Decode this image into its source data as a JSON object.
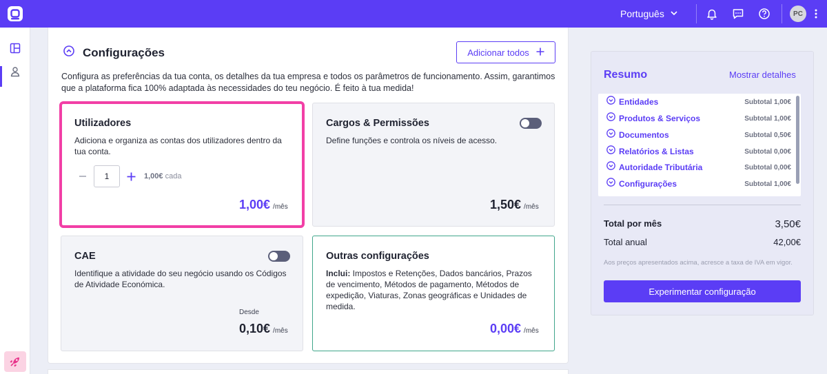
{
  "topbar": {
    "language": "Português",
    "avatar_initials": "PC",
    "brand_color": "#5b3df5"
  },
  "section": {
    "title": "Configurações",
    "add_all_label": "Adicionar todos",
    "description": "Configura as preferências da tua conta, os detalhes da tua empresa e todos os parâmetros de funcionamento. Assim, garantimos que a plataforma fica 100% adaptada às necessidades do teu negócio. É feito à tua medida!"
  },
  "cards": {
    "utilizadores": {
      "title": "Utilizadores",
      "description": "Adiciona e organiza as contas dos utilizadores dentro da tua conta.",
      "quantity": "1",
      "unit_price": "1,00€",
      "unit_suffix": "cada",
      "price": "1,00€",
      "period": "/mês"
    },
    "cargos": {
      "title": "Cargos & Permissões",
      "description": "Define funções e controla os níveis de acesso.",
      "price": "1,50€",
      "period": "/mês",
      "enabled": false
    },
    "cae": {
      "title": "CAE",
      "description": "Identifique a atividade do seu negócio usando os Códigos de Atividade Económica.",
      "from_label": "Desde",
      "price": "0,10€",
      "period": "/mês",
      "enabled": false
    },
    "outras": {
      "title": "Outras configurações",
      "includes_label": "Inclui:",
      "description": " Impostos e Retenções, Dados bancários, Prazos de vencimento, Métodos de pagamento, Métodos de expedição, Viaturas, Zonas geográficas e Unidades de medida.",
      "price": "0,00€",
      "period": "/mês"
    }
  },
  "summary": {
    "title": "Resumo",
    "details_link": "Mostrar detalhes",
    "items": [
      {
        "label": "Entidades",
        "subtotal": "Subtotal 1,00€"
      },
      {
        "label": "Produtos & Serviços",
        "subtotal": "Subtotal 1,00€"
      },
      {
        "label": "Documentos",
        "subtotal": "Subtotal 0,50€"
      },
      {
        "label": "Relatórios & Listas",
        "subtotal": "Subtotal 0,00€"
      },
      {
        "label": "Autoridade Tributária",
        "subtotal": "Subtotal 0,00€"
      },
      {
        "label": "Configurações",
        "subtotal": "Subtotal 1,00€"
      }
    ],
    "total_month_label": "Total por mês",
    "total_month_value": "3,50€",
    "total_year_label": "Total anual",
    "total_year_value": "42,00€",
    "vat_note": "Aos preços apresentados acima, acresce a taxa de IVA em vigor.",
    "try_button": "Experimentar configuração"
  }
}
